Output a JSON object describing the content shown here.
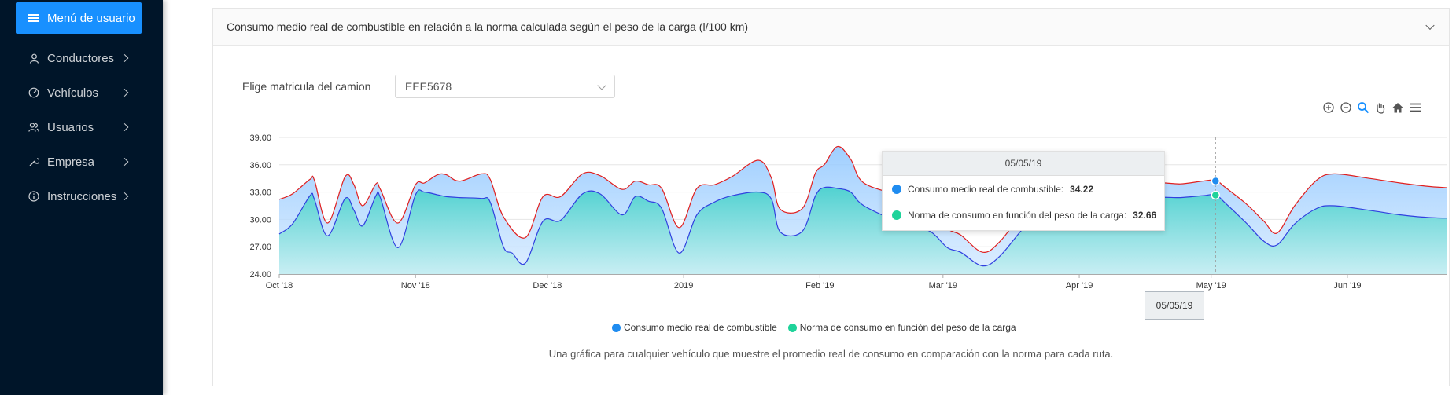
{
  "sidebar": {
    "menu_button": "Menú de usuario",
    "items": [
      {
        "label": "Conductores",
        "icon": "user-icon"
      },
      {
        "label": "Vehículos",
        "icon": "dashboard-icon"
      },
      {
        "label": "Usuarios",
        "icon": "users-icon"
      },
      {
        "label": "Empresa",
        "icon": "tool-icon"
      },
      {
        "label": "Instrucciones",
        "icon": "info-icon"
      }
    ]
  },
  "card": {
    "title": "Consumo medio real de combustible en relación a la norma calculada según el peso de la carga (l/100 km)",
    "select_label": "Elige matricula del camion",
    "select_value": "EEE5678",
    "caption": "Una gráfica para cualquier vehículo que muestre el promedio real de consumo en comparación con la norma para cada ruta."
  },
  "toolbar": [
    "zoom-in-icon",
    "zoom-out-icon",
    "search-zoom-icon",
    "pan-hand-icon",
    "home-icon",
    "menu-icon"
  ],
  "colors": {
    "sidebar": "#001529",
    "accent": "#1890ff",
    "series_actual": "#1f8cf0",
    "series_norm": "#1fd39a",
    "line_actual": "#3040e0",
    "line_norm": "#e02020"
  },
  "tooltip": {
    "date": "05/05/19",
    "xlabel": "05/05/19",
    "rows": [
      {
        "label": "Consumo medio real de combustible:",
        "value": "34.22"
      },
      {
        "label": "Norma de consumo en función del peso de la carga:",
        "value": "32.66"
      }
    ]
  },
  "chart_data": {
    "type": "area",
    "title": "",
    "xlabel": "",
    "ylabel": "",
    "ylim": [
      24,
      39
    ],
    "yticks": [
      "24.00",
      "27.00",
      "30.00",
      "33.00",
      "36.00",
      "39.00"
    ],
    "xticks": [
      {
        "label": "Oct '18",
        "day": 0
      },
      {
        "label": "Nov '18",
        "day": 31
      },
      {
        "label": "Dec '18",
        "day": 61
      },
      {
        "label": "2019",
        "day": 92
      },
      {
        "label": "Feb '19",
        "day": 123
      },
      {
        "label": "Mar '19",
        "day": 151
      },
      {
        "label": "Apr '19",
        "day": 182
      },
      {
        "label": "May '19",
        "day": 212
      },
      {
        "label": "Jun '19",
        "day": 243
      }
    ],
    "x_end_day": 272,
    "grid": true,
    "legend_position": "bottom",
    "series": [
      {
        "name": "Consumo medio real de combustible",
        "line_color": "#e02020",
        "fill": "#9fd0ff",
        "points": [
          [
            0,
            32.2
          ],
          [
            3,
            32.8
          ],
          [
            7,
            34.4
          ],
          [
            8,
            34.3
          ],
          [
            11,
            29.6
          ],
          [
            15,
            34.7
          ],
          [
            17,
            33.8
          ],
          [
            19,
            31.5
          ],
          [
            22,
            33.9
          ],
          [
            23,
            33.3
          ],
          [
            27,
            29.6
          ],
          [
            31,
            33.8
          ],
          [
            33,
            34.0
          ],
          [
            36,
            34.9
          ],
          [
            38,
            34.9
          ],
          [
            41,
            34.2
          ],
          [
            46,
            35.0
          ],
          [
            48,
            34.4
          ],
          [
            51,
            30.3
          ],
          [
            56,
            28.0
          ],
          [
            60,
            32.5
          ],
          [
            64,
            32.5
          ],
          [
            69,
            35.0
          ],
          [
            73,
            34.8
          ],
          [
            78,
            33.3
          ],
          [
            81,
            34.2
          ],
          [
            84,
            33.8
          ],
          [
            87,
            33.4
          ],
          [
            91,
            29.1
          ],
          [
            95,
            33.4
          ],
          [
            99,
            33.8
          ],
          [
            103,
            34.7
          ],
          [
            109,
            36.5
          ],
          [
            112,
            34.5
          ],
          [
            114,
            31.1
          ],
          [
            119,
            31.2
          ],
          [
            122,
            35.1
          ],
          [
            124,
            36.0
          ],
          [
            127,
            38.0
          ],
          [
            130,
            36.6
          ],
          [
            133,
            34.0
          ],
          [
            142,
            32.5
          ],
          [
            148,
            31.3
          ],
          [
            152,
            29.0
          ],
          [
            155,
            28.3
          ],
          [
            160,
            26.4
          ],
          [
            164,
            27.6
          ],
          [
            170,
            31.2
          ],
          [
            177,
            33.9
          ],
          [
            182,
            33.5
          ],
          [
            188,
            33.0
          ],
          [
            195,
            33.5
          ],
          [
            200,
            34.0
          ],
          [
            205,
            33.9
          ],
          [
            210,
            34.2
          ],
          [
            213,
            34.3
          ],
          [
            215,
            33.6
          ],
          [
            220,
            31.7
          ],
          [
            224,
            29.8
          ],
          [
            227,
            28.5
          ],
          [
            231,
            31.5
          ],
          [
            236,
            34.3
          ],
          [
            240,
            35.0
          ],
          [
            248,
            34.5
          ],
          [
            255,
            34.0
          ],
          [
            262,
            33.6
          ],
          [
            272,
            33.3
          ]
        ]
      },
      {
        "name": "Norma de consumo en función del peso de la carga",
        "line_color": "#3040e0",
        "fill": "#3fd3c0",
        "points": [
          [
            0,
            28.4
          ],
          [
            3,
            29.5
          ],
          [
            7,
            32.6
          ],
          [
            8,
            32.2
          ],
          [
            11,
            28.2
          ],
          [
            15,
            32.3
          ],
          [
            17,
            31.0
          ],
          [
            19,
            29.3
          ],
          [
            22,
            32.6
          ],
          [
            23,
            32.4
          ],
          [
            27,
            26.9
          ],
          [
            31,
            32.7
          ],
          [
            33,
            33.0
          ],
          [
            36,
            32.7
          ],
          [
            38,
            32.5
          ],
          [
            41,
            32.4
          ],
          [
            46,
            32.3
          ],
          [
            48,
            31.9
          ],
          [
            51,
            27.0
          ],
          [
            53,
            26.3
          ],
          [
            56,
            25.2
          ],
          [
            60,
            29.8
          ],
          [
            64,
            29.9
          ],
          [
            69,
            32.8
          ],
          [
            73,
            32.8
          ],
          [
            78,
            30.5
          ],
          [
            81,
            32.5
          ],
          [
            84,
            32.0
          ],
          [
            87,
            31.2
          ],
          [
            91,
            26.3
          ],
          [
            95,
            30.5
          ],
          [
            99,
            31.9
          ],
          [
            103,
            32.6
          ],
          [
            109,
            33.0
          ],
          [
            112,
            32.2
          ],
          [
            114,
            28.6
          ],
          [
            119,
            28.7
          ],
          [
            122,
            32.6
          ],
          [
            124,
            33.5
          ],
          [
            127,
            33.4
          ],
          [
            130,
            33.0
          ],
          [
            133,
            31.5
          ],
          [
            142,
            29.5
          ],
          [
            148,
            28.7
          ],
          [
            152,
            26.9
          ],
          [
            155,
            26.4
          ],
          [
            160,
            24.9
          ],
          [
            164,
            26.0
          ],
          [
            170,
            29.4
          ],
          [
            177,
            32.1
          ],
          [
            182,
            31.9
          ],
          [
            188,
            31.5
          ],
          [
            195,
            31.9
          ],
          [
            200,
            32.4
          ],
          [
            205,
            32.4
          ],
          [
            210,
            32.6
          ],
          [
            213,
            32.7
          ],
          [
            215,
            31.9
          ],
          [
            220,
            29.6
          ],
          [
            224,
            27.6
          ],
          [
            227,
            27.2
          ],
          [
            231,
            29.5
          ],
          [
            236,
            31.2
          ],
          [
            240,
            31.5
          ],
          [
            248,
            31.0
          ],
          [
            255,
            30.5
          ],
          [
            262,
            30.2
          ],
          [
            272,
            30.1
          ]
        ]
      }
    ],
    "highlight_day": 213
  }
}
